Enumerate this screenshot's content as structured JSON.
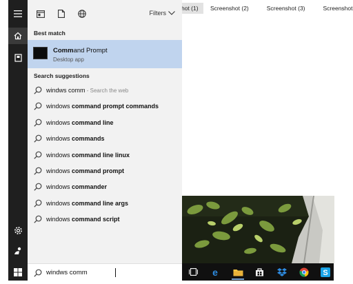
{
  "background_window": {
    "tabs": [
      "hot (1)",
      "Screenshot (2)",
      "Screenshot (3)",
      "Screenshot"
    ]
  },
  "rail": {
    "icons": [
      "hamburger-icon",
      "home-icon",
      "notebook-icon",
      "settings-icon",
      "feedback-icon"
    ]
  },
  "toolbar": {
    "icons": [
      "apps-icon",
      "documents-icon",
      "web-icon"
    ],
    "filters_label": "Filters"
  },
  "best_match": {
    "section_label": "Best match",
    "title_bold": "Comm",
    "title_rest": "and Prompt",
    "subtitle": "Desktop app"
  },
  "search_suggestions": {
    "section_label": "Search suggestions",
    "items": [
      {
        "prefix": "windws comm",
        "bold": "",
        "hint": " - Search the web"
      },
      {
        "prefix": "windows ",
        "bold": "command prompt commands",
        "hint": ""
      },
      {
        "prefix": "windows ",
        "bold": "command line",
        "hint": ""
      },
      {
        "prefix": "windows ",
        "bold": "commands",
        "hint": ""
      },
      {
        "prefix": "windows ",
        "bold": "command line linux",
        "hint": ""
      },
      {
        "prefix": "windows ",
        "bold": "command prompt",
        "hint": ""
      },
      {
        "prefix": "windows ",
        "bold": "commander",
        "hint": ""
      },
      {
        "prefix": "windows ",
        "bold": "command line args",
        "hint": ""
      },
      {
        "prefix": "windows ",
        "bold": "command script",
        "hint": ""
      }
    ]
  },
  "search_box": {
    "value": "windws comm"
  },
  "taskbar": {
    "apps": [
      "task-view-icon",
      "edge-icon",
      "file-explorer-icon",
      "store-icon",
      "dropbox-icon",
      "chrome-icon",
      "skype-icon"
    ],
    "active_app": "file-explorer-icon"
  },
  "colors": {
    "accent_highlight": "#c0d4ee",
    "rail_bg": "#1f1f1f",
    "panel_bg": "#f2f2f2",
    "taskbar_bg": "#101010"
  }
}
